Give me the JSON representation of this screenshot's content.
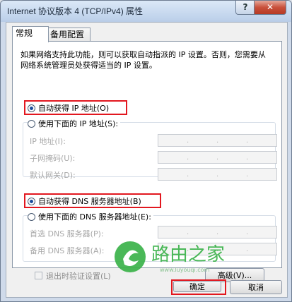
{
  "window": {
    "title": "Internet 协议版本 4 (TCP/IPv4) 属性",
    "help_label": "?",
    "close_label": "✕"
  },
  "tabs": [
    {
      "label": "常规",
      "active": true
    },
    {
      "label": "备用配置",
      "active": false
    }
  ],
  "description": "如果网络支持此功能，则可以获取自动指派的 IP 设置。否则，您需要从网络系统管理员处获得适当的 IP 设置。",
  "ip_section": {
    "auto_label": "自动获得 IP 地址(O)",
    "auto_checked": true,
    "manual_label": "使用下面的 IP 地址(S):",
    "manual_checked": false,
    "fields": [
      {
        "label": "IP 地址(I):",
        "dots": [
          ".",
          ".",
          "."
        ]
      },
      {
        "label": "子网掩码(U):",
        "dots": [
          ".",
          ".",
          "."
        ]
      },
      {
        "label": "默认网关(D):",
        "dots": [
          ".",
          ".",
          "."
        ]
      }
    ]
  },
  "dns_section": {
    "auto_label": "自动获得 DNS 服务器地址(B)",
    "auto_checked": true,
    "manual_label": "使用下面的 DNS 服务器地址(E):",
    "manual_checked": false,
    "fields": [
      {
        "label": "首选 DNS 服务器(P):",
        "dots": [
          ".",
          ".",
          "."
        ]
      },
      {
        "label": "备用 DNS 服务器(A):",
        "dots": [
          ".",
          ".",
          "."
        ]
      }
    ]
  },
  "validate_label": "退出时验证设置(L)",
  "advanced_label": "高级(V)...",
  "ok_label": "确定",
  "cancel_label": "取消",
  "watermark": {
    "text": "路由之家",
    "subtext": "www.luyouqi.com"
  },
  "colors": {
    "highlight": "#e2171f",
    "accent": "#1b4d9d",
    "brand": "#3bb34a"
  }
}
